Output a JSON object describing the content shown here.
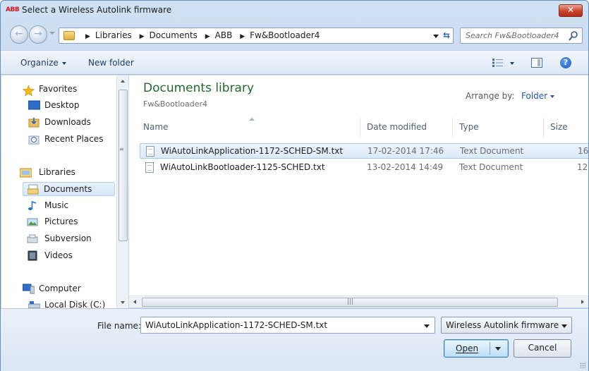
{
  "window": {
    "title": "Select a Wireless Autolink firmware",
    "logo_text": "ABB",
    "close_label": "✕"
  },
  "address": {
    "crumbs": [
      "Libraries",
      "Documents",
      "ABB",
      "Fw&Bootloader4"
    ],
    "search_placeholder": "Search Fw&Bootloader4"
  },
  "toolbar": {
    "organize_label": "Organize",
    "new_folder_label": "New folder",
    "help_label": "?"
  },
  "nav": {
    "items": [
      {
        "label": "Favorites",
        "icon": "star-icon"
      },
      {
        "label": "Desktop",
        "icon": "desktop-icon"
      },
      {
        "label": "Downloads",
        "icon": "downloads-icon"
      },
      {
        "label": "Recent Places",
        "icon": "recent-places-icon"
      },
      {
        "label": "Libraries",
        "icon": "libraries-icon"
      },
      {
        "label": "Documents",
        "icon": "documents-icon",
        "selected": true
      },
      {
        "label": "Music",
        "icon": "music-icon"
      },
      {
        "label": "Pictures",
        "icon": "pictures-icon"
      },
      {
        "label": "Subversion",
        "icon": "subversion-icon"
      },
      {
        "label": "Videos",
        "icon": "videos-icon"
      },
      {
        "label": "Computer",
        "icon": "computer-icon"
      },
      {
        "label": "Local Disk (C:)",
        "icon": "local-disk-icon"
      }
    ]
  },
  "library": {
    "title": "Documents library",
    "subtitle": "Fw&Bootloader4",
    "arrange_label": "Arrange by:",
    "arrange_value": "Folder"
  },
  "columns": {
    "name": "Name",
    "date": "Date modified",
    "type": "Type",
    "size": "Size"
  },
  "files": [
    {
      "name": "WiAutoLinkApplication-1172-SCHED-SM.txt",
      "date": "17-02-2014 17:46",
      "type": "Text Document",
      "size": "16",
      "selected": true
    },
    {
      "name": "WiAutoLinkBootloader-1125-SCHED.txt",
      "date": "13-02-2014 14:49",
      "type": "Text Document",
      "size": "12"
    }
  ],
  "bottom": {
    "filename_label": "File name:",
    "filename_value": "WiAutoLinkApplication-1172-SCHED-SM.txt",
    "filter_value": "Wireless Autolink firmware (",
    "open_label": "Open",
    "cancel_label": "Cancel"
  },
  "colors": {
    "accent": "#1e5aa8",
    "library_title": "#1e6b2a",
    "logo": "#d7191f",
    "close": "#c8442a"
  }
}
